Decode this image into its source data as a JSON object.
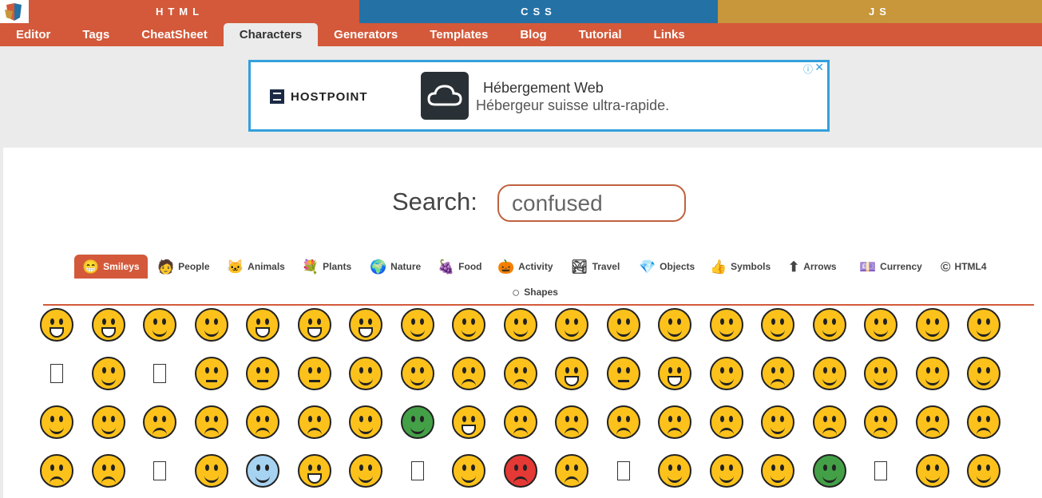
{
  "header": {
    "html_label": "HTML",
    "css_label": "CSS",
    "js_label": "JS",
    "logo_icon": "html-shield-logo-icon",
    "colors": {
      "html": "#d3593a",
      "css": "#2471a6",
      "js": "#c8963b"
    }
  },
  "nav": {
    "items": [
      "Editor",
      "Tags",
      "CheatSheet",
      "Characters",
      "Generators",
      "Templates",
      "Blog",
      "Tutorial",
      "Links"
    ],
    "active": "Characters"
  },
  "ad": {
    "brand": "HOSTPOINT",
    "title": "Hébergement Web",
    "subtitle": "Hébergeur suisse ultra-rapide.",
    "info_icon": "info-icon",
    "close_icon": "close-icon",
    "border_color": "#32a0dc"
  },
  "search": {
    "label": "Search:",
    "value": "confused"
  },
  "categories": [
    {
      "label": "Smileys",
      "icon": "😁",
      "active": true
    },
    {
      "label": "People",
      "icon": "🧑"
    },
    {
      "label": "Animals",
      "icon": "🐱"
    },
    {
      "label": "Plants",
      "icon": "💐"
    },
    {
      "label": "Nature",
      "icon": "🌍"
    },
    {
      "label": "Food",
      "icon": "🍇"
    },
    {
      "label": "Activity",
      "icon": "🎃"
    },
    {
      "label": "Travel",
      "icon": "🏞"
    },
    {
      "label": "Objects",
      "icon": "💎"
    },
    {
      "label": "Symbols",
      "icon": "👍"
    },
    {
      "label": "Arrows",
      "icon": "⬆"
    },
    {
      "label": "Currency",
      "icon": "💷"
    },
    {
      "label": "HTML4",
      "icon": "©"
    },
    {
      "label": "Shapes",
      "icon": "○"
    }
  ],
  "emoji_rows": [
    [
      "grinning-face",
      "beaming-face",
      "face-with-tears-of-joy",
      "rolling-on-floor-laughing",
      "smiling-face-open-mouth",
      "grinning-smiling-eyes",
      "grinning-sweat",
      "squinting-face",
      "winking-face",
      "smiling-blush",
      "savoring-food",
      "sunglasses-face",
      "heart-eyes",
      "face-blowing-kiss",
      "kissing-face",
      "kissing-smiling-eyes",
      "kissing-closed-eyes",
      "slightly-smiling-face",
      "hugging-face"
    ],
    [
      "missing-glyph",
      "thinking-face",
      "missing-glyph",
      "neutral-face",
      "expressionless-face",
      "face-without-mouth",
      "face-rolling-eyes",
      "smirking-face",
      "persevering-face",
      "sad-relieved-face",
      "hushed-face",
      "zipper-mouth-face",
      "face-open-mouth",
      "sleepy-face",
      "tired-face",
      "sleeping-face",
      "relieved-face",
      "face-with-tongue",
      "winking-tongue"
    ],
    [
      "squinting-tongue",
      "drooling-face",
      "unamused-face",
      "downcast-sweat",
      "pensive-face",
      "confused-face",
      "grimacing-face",
      "money-mouth-face",
      "astonished-face",
      "frowning-face",
      "slightly-frowning-face",
      "confounded-face",
      "disappointed-face",
      "worried-face",
      "face-with-steam",
      "crying-face",
      "loudly-crying-face",
      "frowning-open-mouth",
      "anguished-face"
    ],
    [
      "fearful-face",
      "weary-face",
      "missing-glyph",
      "grimacing-face",
      "anxious-sweat",
      "screaming-face",
      "flushed-face",
      "missing-glyph",
      "dizzy-face",
      "pouting-face",
      "angry-face",
      "missing-glyph",
      "face-with-mask",
      "face-with-thermometer",
      "head-bandage",
      "nauseated-face",
      "missing-glyph",
      "sneezing-face",
      "smiling-halo"
    ]
  ]
}
